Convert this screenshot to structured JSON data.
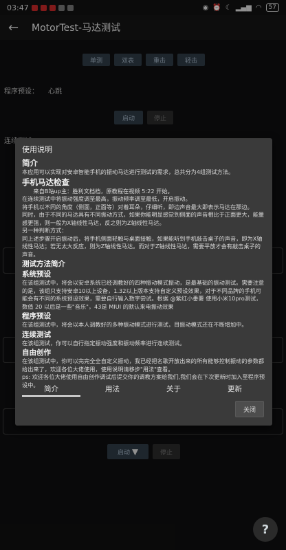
{
  "status_bar": {
    "time": "03:47",
    "battery": "57"
  },
  "app_bar": {
    "title": "MotorTest-马达测试"
  },
  "background": {
    "top_buttons": [
      "单测",
      "双表",
      "重击",
      "轻击"
    ],
    "preset_label": "程序预设：",
    "preset_value": "心跳",
    "start_label": "启动",
    "stop_label": "停止",
    "continuous_label": "连续测试",
    "start_label_2": "启动",
    "stop_label_2": "停止"
  },
  "dialog": {
    "title": "使用说明",
    "content": [
      {
        "type": "h1",
        "text": "简介"
      },
      {
        "type": "p",
        "text": "本应用可以实现对安卓智能手机的振动马达进行测试的需求，总共分为4组测试方法。"
      },
      {
        "type": "h1",
        "text": "手机马达检查"
      },
      {
        "type": "p",
        "text": "　　来自B站up主：胜利文档档，原教程在视频 5:22 开始。"
      },
      {
        "type": "p",
        "text": "在连续测试中将振动强度调至最高，振动频率调至最低，开启振动。"
      },
      {
        "type": "p",
        "text": "将手机以不同的角度（侧面，正面等）对着耳朵，仔细听，即边声音最大即表示马达在那边。"
      },
      {
        "type": "p",
        "text": "同时，由于不同的马达具有不同振动方式，如果你能明显感觉到侧面的声音相比于正面更大，能量感更强，则一般为X轴线性马达，反之则为Z轴线性马达。"
      },
      {
        "type": "p",
        "text": "另一种判断方式："
      },
      {
        "type": "p",
        "text": "同上述步骤开启振动后，将手机侧面轻触与桌面接触，如果能听到手机敲击桌子的声音，即为X轴线性马达；若无太大反应，则为Z轴线性马达。而对于Z轴线性马达，需要平放才会有敲击桌子的声音。"
      },
      {
        "type": "h2",
        "text": "测试方法简介"
      },
      {
        "type": "h2",
        "text": "系统预设"
      },
      {
        "type": "p",
        "text": "在该组测试中，将会以安卓系统已经调教好的四种振动模式振动，是最基础的振动测试。需要注意的是，该组只支持安卓10以上设备，1.32以上版本支持自定义预设效果，对于不同品牌的手机可能会有不同的系统预设效果，需要自行输入数字尝试。根据 @紫红小番薯 使用小米10pro测试，数值 20 以后是一些\"音乐\"，43是 MIUI 的默认来电振动效果"
      },
      {
        "type": "h2",
        "text": "程序预设"
      },
      {
        "type": "p",
        "text": "在该组测试中，将会以本人调教好的多种振动模式进行测试，目振动模式还在不断增加中。"
      },
      {
        "type": "h2",
        "text": "连续测试"
      },
      {
        "type": "p",
        "text": "在该组测试，你可以自行指定振动强度和振动频率进行连续测试。"
      },
      {
        "type": "h2",
        "text": "自由创作"
      },
      {
        "type": "p",
        "text": "在该组测试中，你可以完完全全自定义振动，我已经把名歌开放出来的所有能够控制振动的参数都给出来了，欢迎各位大佬使用，使用说明请移步\"用法\"查看。"
      },
      {
        "type": "p",
        "text": "ps: 欢迎各位大佬使用自由创作调试后提交你的调教方案给我们,我们会在下次更新时加入至程序预设中。"
      }
    ],
    "tabs": [
      "简介",
      "用法",
      "关于",
      "更新"
    ],
    "close_label": "关闭"
  },
  "fab": {
    "label": "?"
  }
}
